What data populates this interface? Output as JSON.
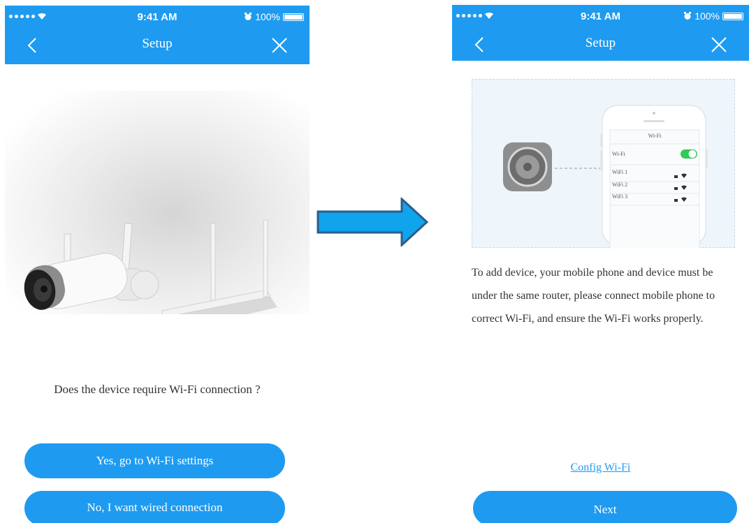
{
  "colors": {
    "accent": "#1e9bf0",
    "arrow_fill": "#10a4ec",
    "arrow_stroke": "#2d5d8a"
  },
  "icons": [
    "signal-dots",
    "wifi-icon",
    "alarm-icon",
    "battery-icon",
    "back-chevron-icon",
    "close-x-icon",
    "settings-gear-icon",
    "lock-icon",
    "arrow-right-icon"
  ],
  "left_screen": {
    "status": {
      "time": "9:41 AM",
      "battery": "100%"
    },
    "nav": {
      "title": "Setup"
    },
    "question": "Does the device require Wi-Fi connection ?",
    "yes_button": "Yes, go to Wi-Fi settings",
    "no_button": "No, I want wired connection"
  },
  "right_screen": {
    "status": {
      "time": "9:41 AM",
      "battery": "100%"
    },
    "nav": {
      "title": "Setup"
    },
    "phone": {
      "header": "Wi-Fi",
      "toggle_label": "Wi-Fi",
      "toggle_on": true,
      "networks": [
        "WiFi 1",
        "WiFi 2",
        "WiFi 3"
      ]
    },
    "description": "To add device, your mobile phone and device must be under the same router, please connect mobile phone to correct Wi-Fi, and ensure the Wi-Fi works properly.",
    "config_link": "Config Wi-Fi",
    "next_button": "Next"
  }
}
